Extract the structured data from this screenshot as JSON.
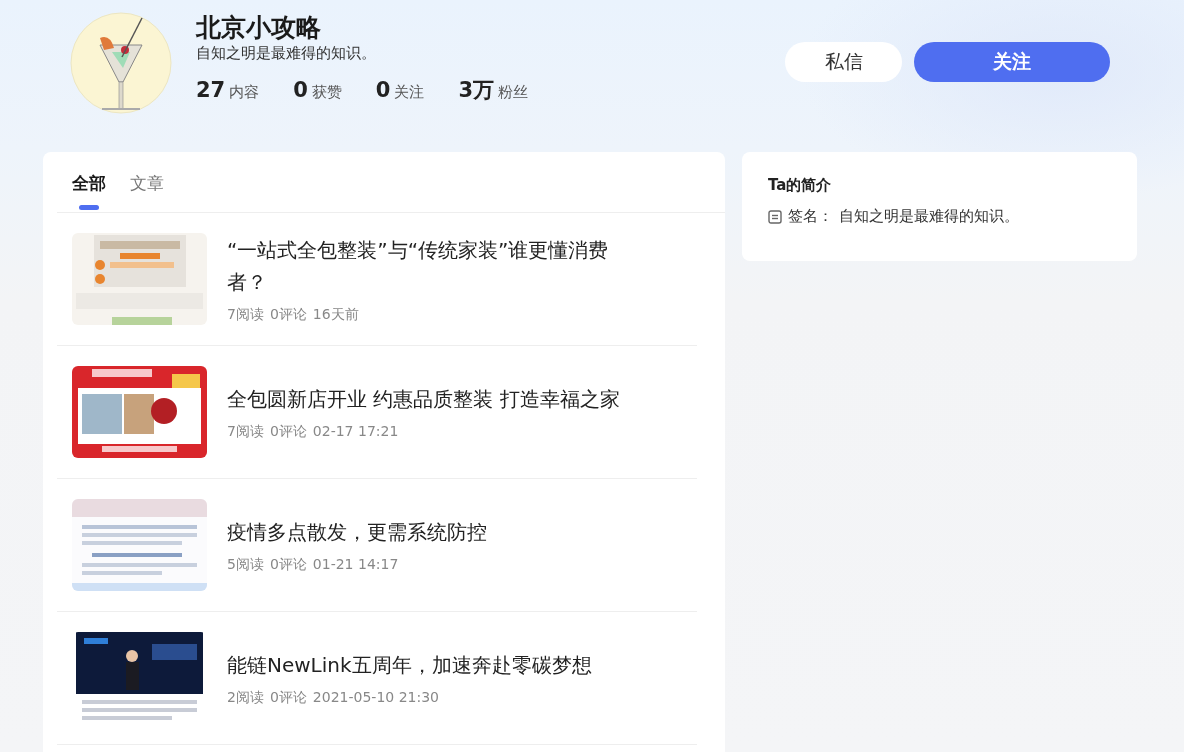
{
  "profile": {
    "name": "北京小攻略",
    "signature": "自知之明是最难得的知识。",
    "stats": [
      {
        "value": "27",
        "label": "内容"
      },
      {
        "value": "0",
        "label": "获赞"
      },
      {
        "value": "0",
        "label": "关注"
      },
      {
        "value": "3万",
        "label": "粉丝"
      }
    ]
  },
  "buttons": [
    {
      "label": "私信",
      "kind": "secondary"
    },
    {
      "label": "关注",
      "kind": "primary"
    }
  ],
  "tabs": [
    {
      "label": "全部",
      "selected": true
    },
    {
      "label": "文章",
      "selected": false
    }
  ],
  "articles": [
    {
      "title": "“一站式全包整装”与“传统家装”谁更懂消费者？",
      "reads": "7阅读",
      "comments": "0评论",
      "time": "16天前"
    },
    {
      "title": "全包圆新店开业 约惠品质整装 打造幸福之家",
      "reads": "7阅读",
      "comments": "0评论",
      "time": "02-17 17:21"
    },
    {
      "title": "疫情多点散发，更需系统防控",
      "reads": "5阅读",
      "comments": "0评论",
      "time": "01-21 14:17"
    },
    {
      "title": "能链NewLink五周年，加速奔赴零碳梦想",
      "reads": "2阅读",
      "comments": "0评论",
      "time": "2021-05-10 21:30"
    }
  ],
  "intro": {
    "title": "Ta的简介",
    "signature_label": "签名：",
    "signature": "自知之明是最难得的知识。"
  }
}
